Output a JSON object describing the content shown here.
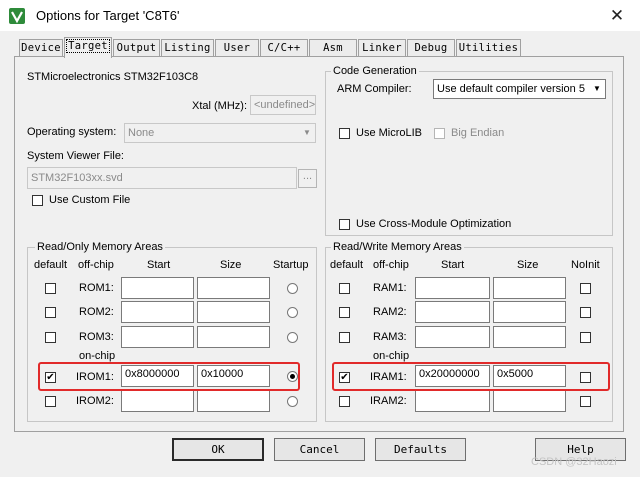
{
  "window": {
    "title": "Options for Target 'C8T6'",
    "close_glyph": "✕"
  },
  "tabs": [
    "Device",
    "Target",
    "Output",
    "Listing",
    "User",
    "C/C++",
    "Asm",
    "Linker",
    "Debug",
    "Utilities"
  ],
  "device": {
    "name": "STMicroelectronics STM32F103C8",
    "xtal_label": "Xtal (MHz):",
    "xtal_value": "<undefined>",
    "os_label": "Operating system:",
    "os_value": "None",
    "svd_label": "System Viewer File:",
    "svd_value": "STM32F103xx.svd",
    "browse_label": "...",
    "use_custom_file": "Use Custom File"
  },
  "codegen": {
    "title": "Code Generation",
    "compiler_label": "ARM Compiler:",
    "compiler_value": "Use default compiler version 5",
    "microlib": "Use MicroLIB",
    "big_endian": "Big Endian",
    "cross_module": "Use Cross-Module Optimization"
  },
  "rom": {
    "title": "Read/Only Memory Areas",
    "headers": {
      "default": "default",
      "offchip": "off-chip",
      "start": "Start",
      "size": "Size",
      "startup": "Startup"
    },
    "onchip_label": "on-chip",
    "rows": [
      {
        "name": "ROM1:",
        "start": "",
        "size": ""
      },
      {
        "name": "ROM2:",
        "start": "",
        "size": ""
      },
      {
        "name": "ROM3:",
        "start": "",
        "size": ""
      },
      {
        "name": "IROM1:",
        "start": "0x8000000",
        "size": "0x10000"
      },
      {
        "name": "IROM2:",
        "start": "",
        "size": ""
      }
    ]
  },
  "ram": {
    "title": "Read/Write Memory Areas",
    "headers": {
      "default": "default",
      "offchip": "off-chip",
      "start": "Start",
      "size": "Size",
      "noinit": "NoInit"
    },
    "onchip_label": "on-chip",
    "rows": [
      {
        "name": "RAM1:",
        "start": "",
        "size": ""
      },
      {
        "name": "RAM2:",
        "start": "",
        "size": ""
      },
      {
        "name": "RAM3:",
        "start": "",
        "size": ""
      },
      {
        "name": "IRAM1:",
        "start": "0x20000000",
        "size": "0x5000"
      },
      {
        "name": "IRAM2:",
        "start": "",
        "size": ""
      }
    ]
  },
  "buttons": {
    "ok": "OK",
    "cancel": "Cancel",
    "defaults": "Defaults",
    "help": "Help"
  },
  "checked_glyph": "✔",
  "watermark": "CSDN @32Haozi",
  "colors": {
    "highlight": "#e12a2a",
    "dialog_bg": "#f0f0f0",
    "app_icon_green": "#2e8b3a"
  }
}
